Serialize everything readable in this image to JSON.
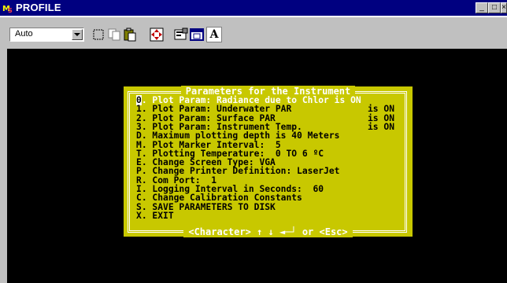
{
  "window": {
    "title": "PROFILE",
    "buttons": {
      "minimize": "_",
      "maximize": "□",
      "close": "×"
    }
  },
  "toolbar": {
    "font_select_value": "Auto",
    "buttons": [
      "mark-icon",
      "copy-icon",
      "paste-icon",
      "fullscreen-icon",
      "properties-icon",
      "background-icon",
      "font-icon"
    ],
    "font_button_label": "A"
  },
  "dialog": {
    "title": "Parameters for the Instrument",
    "footer": "<Character> ↑ ↓ ◄─┘ or <Esc>",
    "items": [
      {
        "key": "0",
        "text": ". Plot Param: Radiance due to Chlor is ON",
        "status": ""
      },
      {
        "key": "1",
        "text": ". Plot Param: Underwater PAR",
        "status": "is ON"
      },
      {
        "key": "2",
        "text": ". Plot Param: Surface PAR",
        "status": "is ON"
      },
      {
        "key": "3",
        "text": ". Plot Param: Instrument Temp.",
        "status": "is ON"
      },
      {
        "key": "D",
        "text": ". Maximum plotting depth is 40 Meters",
        "status": ""
      },
      {
        "key": "M",
        "text": ". Plot Marker Interval:  5",
        "status": ""
      },
      {
        "key": "T",
        "text": ". Plotting Temperature:  0 TO 6 ºC",
        "status": ""
      },
      {
        "key": "E",
        "text": ". Change Screen Type: VGA",
        "status": ""
      },
      {
        "key": "P",
        "text": ". Change Printer Definition: LaserJet",
        "status": ""
      },
      {
        "key": "R",
        "text": ". Com Port:  1",
        "status": ""
      },
      {
        "key": "I",
        "text": ". Logging Interval in Seconds:  60",
        "status": ""
      },
      {
        "key": "C",
        "text": ". Change Calibration Constants",
        "status": ""
      },
      {
        "key": "S",
        "text": ". SAVE PARAMETERS TO DISK",
        "status": ""
      },
      {
        "key": "X",
        "text": ". EXIT",
        "status": ""
      }
    ]
  },
  "colors": {
    "title_bar": "#000080",
    "dialog_bg": "#c8c800",
    "console_bg": "#000000",
    "chrome": "#c0c0c0"
  }
}
